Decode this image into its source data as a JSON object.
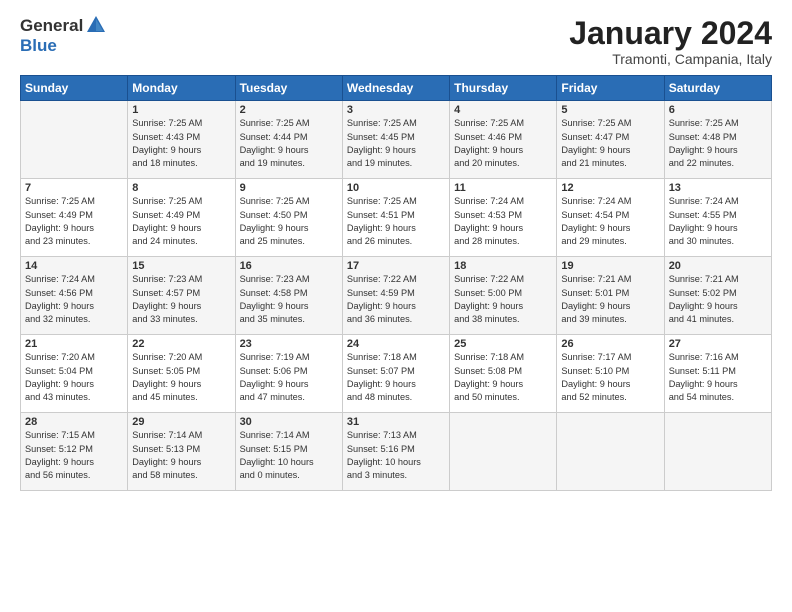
{
  "header": {
    "logo_line1": "General",
    "logo_line2": "Blue",
    "month_title": "January 2024",
    "location": "Tramonti, Campania, Italy"
  },
  "days_of_week": [
    "Sunday",
    "Monday",
    "Tuesday",
    "Wednesday",
    "Thursday",
    "Friday",
    "Saturday"
  ],
  "weeks": [
    [
      {
        "day": "",
        "info": ""
      },
      {
        "day": "1",
        "info": "Sunrise: 7:25 AM\nSunset: 4:43 PM\nDaylight: 9 hours\nand 18 minutes."
      },
      {
        "day": "2",
        "info": "Sunrise: 7:25 AM\nSunset: 4:44 PM\nDaylight: 9 hours\nand 19 minutes."
      },
      {
        "day": "3",
        "info": "Sunrise: 7:25 AM\nSunset: 4:45 PM\nDaylight: 9 hours\nand 19 minutes."
      },
      {
        "day": "4",
        "info": "Sunrise: 7:25 AM\nSunset: 4:46 PM\nDaylight: 9 hours\nand 20 minutes."
      },
      {
        "day": "5",
        "info": "Sunrise: 7:25 AM\nSunset: 4:47 PM\nDaylight: 9 hours\nand 21 minutes."
      },
      {
        "day": "6",
        "info": "Sunrise: 7:25 AM\nSunset: 4:48 PM\nDaylight: 9 hours\nand 22 minutes."
      }
    ],
    [
      {
        "day": "7",
        "info": "Sunrise: 7:25 AM\nSunset: 4:49 PM\nDaylight: 9 hours\nand 23 minutes."
      },
      {
        "day": "8",
        "info": "Sunrise: 7:25 AM\nSunset: 4:49 PM\nDaylight: 9 hours\nand 24 minutes."
      },
      {
        "day": "9",
        "info": "Sunrise: 7:25 AM\nSunset: 4:50 PM\nDaylight: 9 hours\nand 25 minutes."
      },
      {
        "day": "10",
        "info": "Sunrise: 7:25 AM\nSunset: 4:51 PM\nDaylight: 9 hours\nand 26 minutes."
      },
      {
        "day": "11",
        "info": "Sunrise: 7:24 AM\nSunset: 4:53 PM\nDaylight: 9 hours\nand 28 minutes."
      },
      {
        "day": "12",
        "info": "Sunrise: 7:24 AM\nSunset: 4:54 PM\nDaylight: 9 hours\nand 29 minutes."
      },
      {
        "day": "13",
        "info": "Sunrise: 7:24 AM\nSunset: 4:55 PM\nDaylight: 9 hours\nand 30 minutes."
      }
    ],
    [
      {
        "day": "14",
        "info": "Sunrise: 7:24 AM\nSunset: 4:56 PM\nDaylight: 9 hours\nand 32 minutes."
      },
      {
        "day": "15",
        "info": "Sunrise: 7:23 AM\nSunset: 4:57 PM\nDaylight: 9 hours\nand 33 minutes."
      },
      {
        "day": "16",
        "info": "Sunrise: 7:23 AM\nSunset: 4:58 PM\nDaylight: 9 hours\nand 35 minutes."
      },
      {
        "day": "17",
        "info": "Sunrise: 7:22 AM\nSunset: 4:59 PM\nDaylight: 9 hours\nand 36 minutes."
      },
      {
        "day": "18",
        "info": "Sunrise: 7:22 AM\nSunset: 5:00 PM\nDaylight: 9 hours\nand 38 minutes."
      },
      {
        "day": "19",
        "info": "Sunrise: 7:21 AM\nSunset: 5:01 PM\nDaylight: 9 hours\nand 39 minutes."
      },
      {
        "day": "20",
        "info": "Sunrise: 7:21 AM\nSunset: 5:02 PM\nDaylight: 9 hours\nand 41 minutes."
      }
    ],
    [
      {
        "day": "21",
        "info": "Sunrise: 7:20 AM\nSunset: 5:04 PM\nDaylight: 9 hours\nand 43 minutes."
      },
      {
        "day": "22",
        "info": "Sunrise: 7:20 AM\nSunset: 5:05 PM\nDaylight: 9 hours\nand 45 minutes."
      },
      {
        "day": "23",
        "info": "Sunrise: 7:19 AM\nSunset: 5:06 PM\nDaylight: 9 hours\nand 47 minutes."
      },
      {
        "day": "24",
        "info": "Sunrise: 7:18 AM\nSunset: 5:07 PM\nDaylight: 9 hours\nand 48 minutes."
      },
      {
        "day": "25",
        "info": "Sunrise: 7:18 AM\nSunset: 5:08 PM\nDaylight: 9 hours\nand 50 minutes."
      },
      {
        "day": "26",
        "info": "Sunrise: 7:17 AM\nSunset: 5:10 PM\nDaylight: 9 hours\nand 52 minutes."
      },
      {
        "day": "27",
        "info": "Sunrise: 7:16 AM\nSunset: 5:11 PM\nDaylight: 9 hours\nand 54 minutes."
      }
    ],
    [
      {
        "day": "28",
        "info": "Sunrise: 7:15 AM\nSunset: 5:12 PM\nDaylight: 9 hours\nand 56 minutes."
      },
      {
        "day": "29",
        "info": "Sunrise: 7:14 AM\nSunset: 5:13 PM\nDaylight: 9 hours\nand 58 minutes."
      },
      {
        "day": "30",
        "info": "Sunrise: 7:14 AM\nSunset: 5:15 PM\nDaylight: 10 hours\nand 0 minutes."
      },
      {
        "day": "31",
        "info": "Sunrise: 7:13 AM\nSunset: 5:16 PM\nDaylight: 10 hours\nand 3 minutes."
      },
      {
        "day": "",
        "info": ""
      },
      {
        "day": "",
        "info": ""
      },
      {
        "day": "",
        "info": ""
      }
    ]
  ]
}
